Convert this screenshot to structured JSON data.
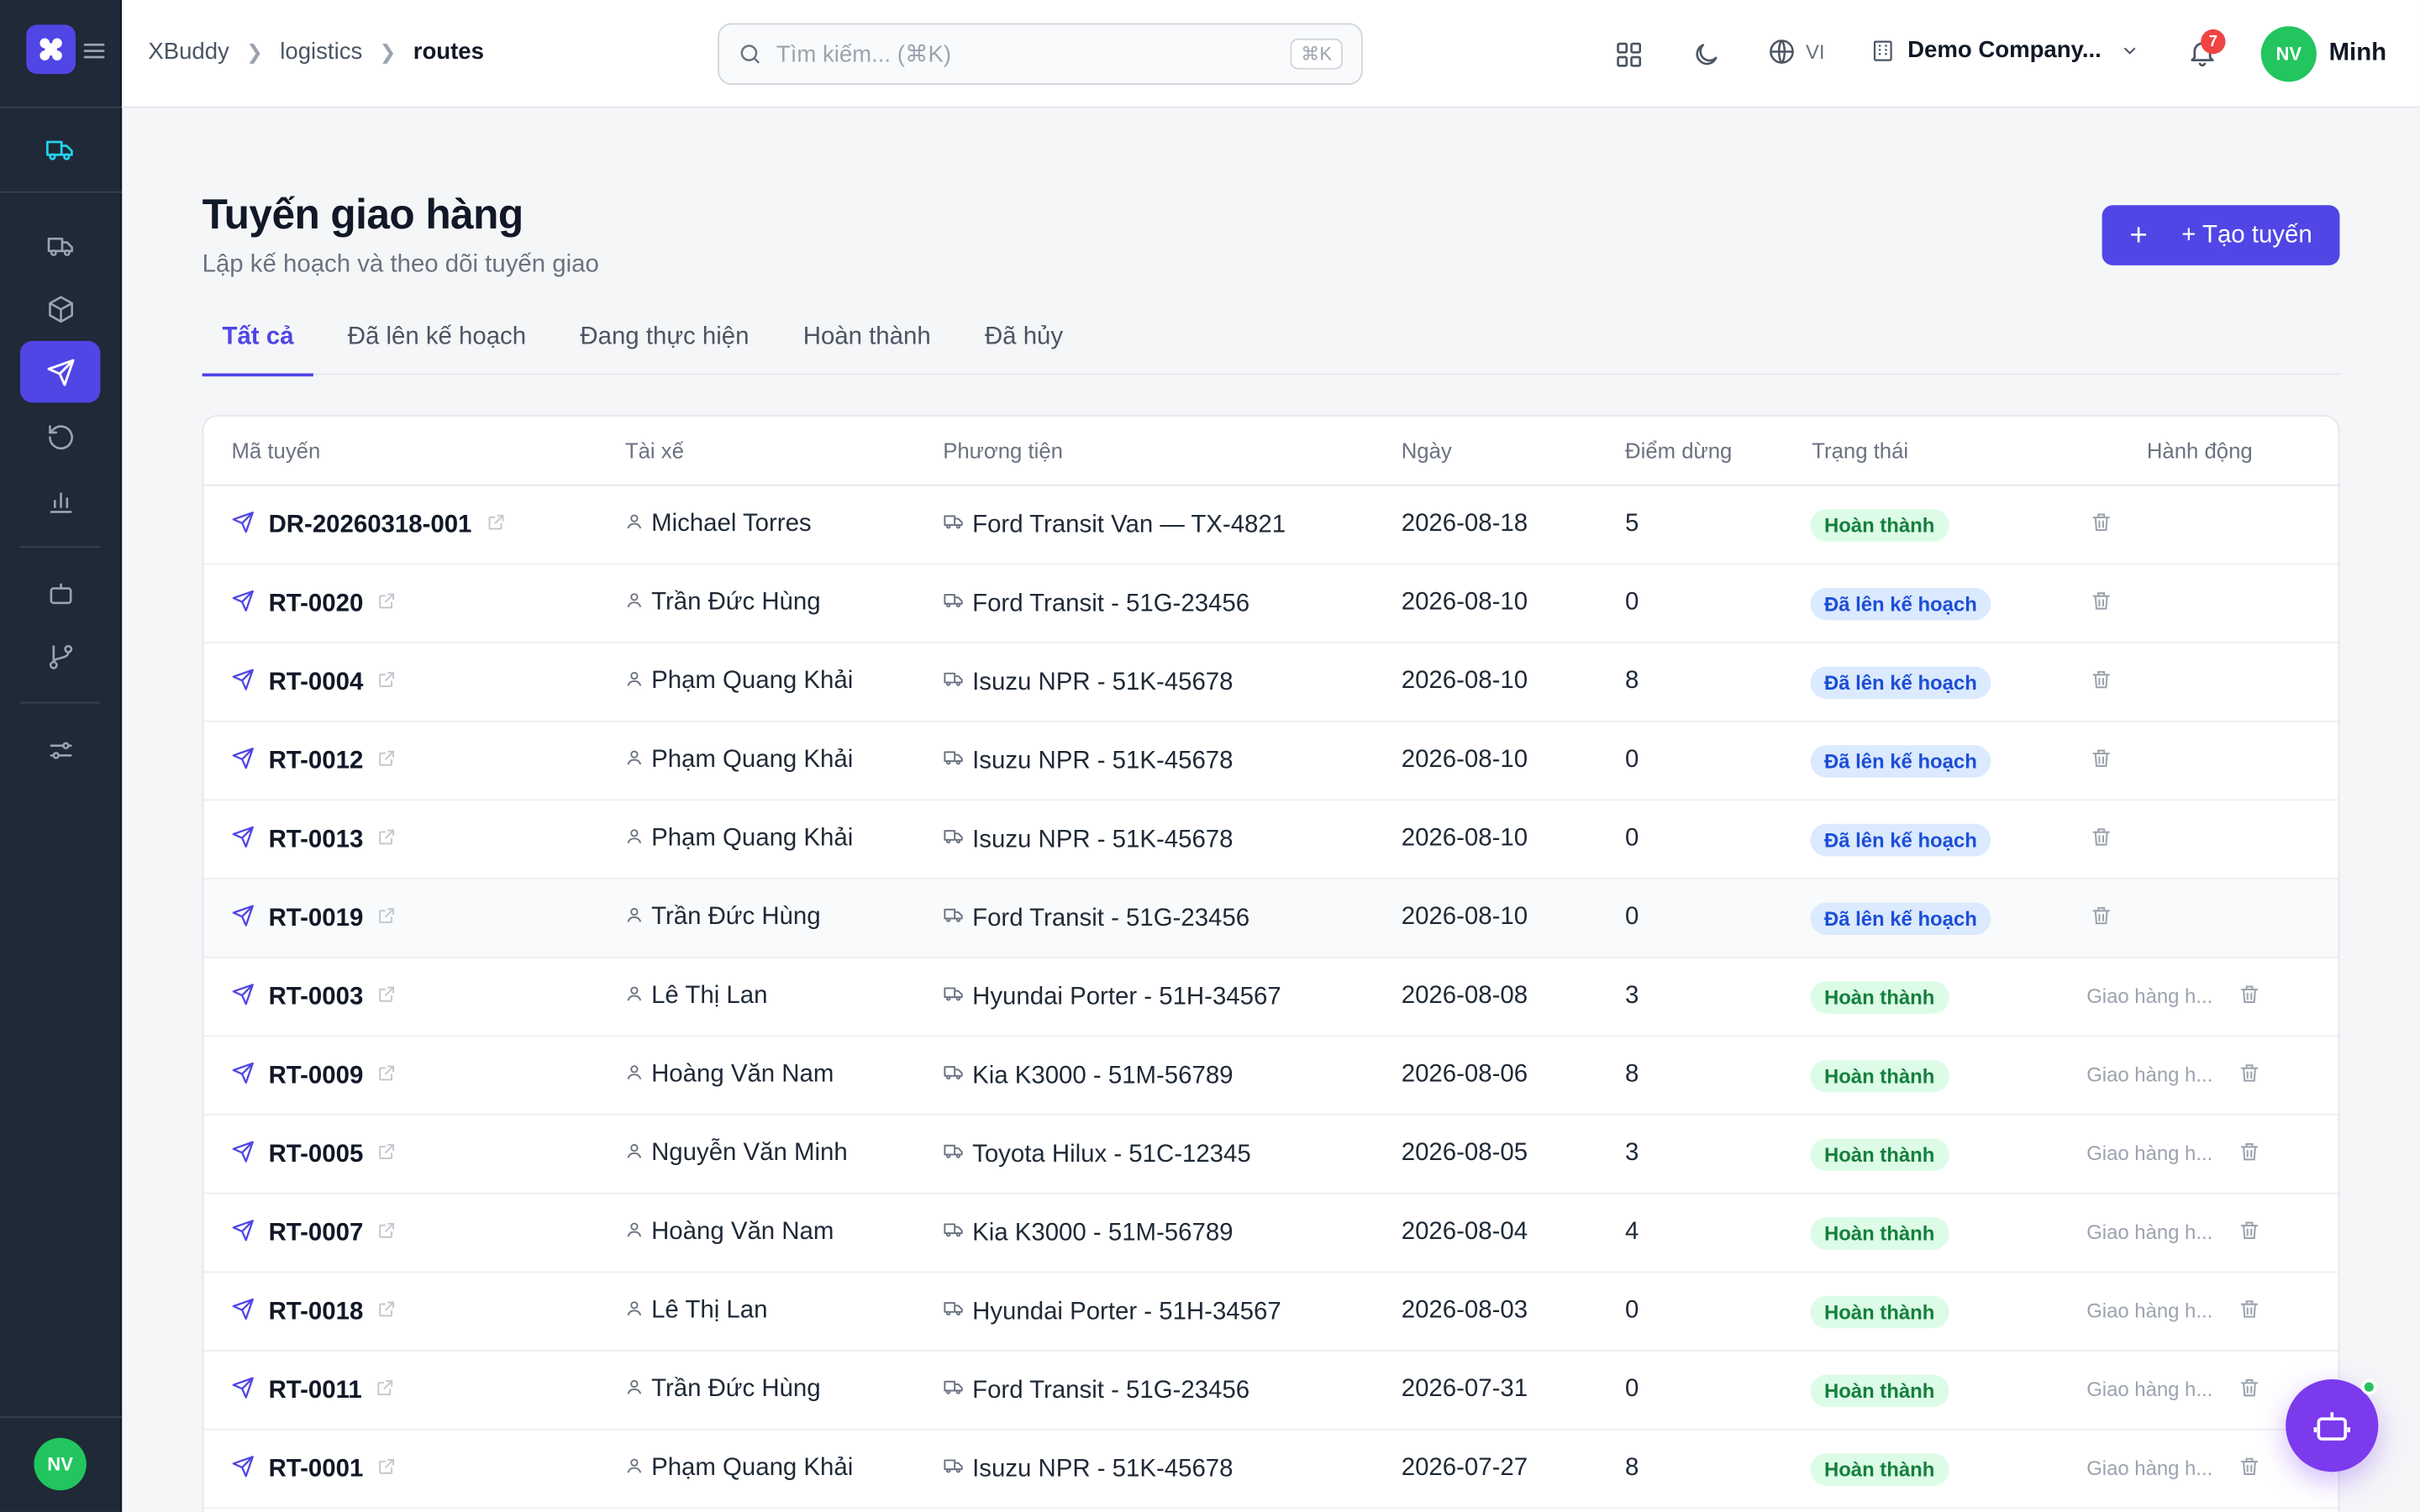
{
  "header": {
    "breadcrumbs": [
      "XBuddy",
      "logistics",
      "routes"
    ],
    "search_placeholder": "Tìm kiếm... (⌘K)",
    "search_shortcut": "⌘K",
    "language": "VI",
    "company": "Demo Company...",
    "notification_count": "7",
    "user_initials": "NV",
    "user_name": "Minh"
  },
  "sidebar": {
    "avatar_initials": "NV",
    "items": [
      "truck-icon",
      "truck-icon",
      "package-icon",
      "send-icon",
      "history-icon",
      "bar-chart-icon",
      "robot-icon",
      "git-branch-icon",
      "sliders-icon"
    ]
  },
  "page": {
    "title": "Tuyến giao hàng",
    "subtitle": "Lập kế hoạch và theo dõi tuyến giao",
    "create_label": "+ Tạo tuyến",
    "create_plus": "+"
  },
  "tabs": [
    "Tất cả",
    "Đã lên kế hoạch",
    "Đang thực hiện",
    "Hoàn thành",
    "Đã hủy"
  ],
  "table": {
    "headers": [
      "Mã tuyến",
      "Tài xế",
      "Phương tiện",
      "Ngày",
      "Điểm dừng",
      "Trạng thái",
      "Hành động"
    ],
    "rows": [
      {
        "code": "DR-20260318-001",
        "driver": "Michael Torres",
        "vehicle": "Ford Transit Van — TX-4821",
        "date": "2026-08-18",
        "stops": "5",
        "status": "Hoàn thành",
        "note": ""
      },
      {
        "code": "RT-0020",
        "driver": "Trần Đức Hùng",
        "vehicle": "Ford Transit - 51G-23456",
        "date": "2026-08-10",
        "stops": "0",
        "status": "Đã lên kế hoạch",
        "note": ""
      },
      {
        "code": "RT-0004",
        "driver": "Phạm Quang Khải",
        "vehicle": "Isuzu NPR - 51K-45678",
        "date": "2026-08-10",
        "stops": "8",
        "status": "Đã lên kế hoạch",
        "note": ""
      },
      {
        "code": "RT-0012",
        "driver": "Phạm Quang Khải",
        "vehicle": "Isuzu NPR - 51K-45678",
        "date": "2026-08-10",
        "stops": "0",
        "status": "Đã lên kế hoạch",
        "note": ""
      },
      {
        "code": "RT-0013",
        "driver": "Phạm Quang Khải",
        "vehicle": "Isuzu NPR - 51K-45678",
        "date": "2026-08-10",
        "stops": "0",
        "status": "Đã lên kế hoạch",
        "note": ""
      },
      {
        "code": "RT-0019",
        "driver": "Trần Đức Hùng",
        "vehicle": "Ford Transit - 51G-23456",
        "date": "2026-08-10",
        "stops": "0",
        "status": "Đã lên kế hoạch",
        "note": ""
      },
      {
        "code": "RT-0003",
        "driver": "Lê Thị Lan",
        "vehicle": "Hyundai Porter - 51H-34567",
        "date": "2026-08-08",
        "stops": "3",
        "status": "Hoàn thành",
        "note": "Giao hàng h..."
      },
      {
        "code": "RT-0009",
        "driver": "Hoàng Văn Nam",
        "vehicle": "Kia K3000 - 51M-56789",
        "date": "2026-08-06",
        "stops": "8",
        "status": "Hoàn thành",
        "note": "Giao hàng h..."
      },
      {
        "code": "RT-0005",
        "driver": "Nguyễn Văn Minh",
        "vehicle": "Toyota Hilux - 51C-12345",
        "date": "2026-08-05",
        "stops": "3",
        "status": "Hoàn thành",
        "note": "Giao hàng h..."
      },
      {
        "code": "RT-0007",
        "driver": "Hoàng Văn Nam",
        "vehicle": "Kia K3000 - 51M-56789",
        "date": "2026-08-04",
        "stops": "4",
        "status": "Hoàn thành",
        "note": "Giao hàng h..."
      },
      {
        "code": "RT-0018",
        "driver": "Lê Thị Lan",
        "vehicle": "Hyundai Porter - 51H-34567",
        "date": "2026-08-03",
        "stops": "0",
        "status": "Hoàn thành",
        "note": "Giao hàng h..."
      },
      {
        "code": "RT-0011",
        "driver": "Trần Đức Hùng",
        "vehicle": "Ford Transit - 51G-23456",
        "date": "2026-07-31",
        "stops": "0",
        "status": "Hoàn thành",
        "note": "Giao hàng h..."
      },
      {
        "code": "RT-0001",
        "driver": "Phạm Quang Khải",
        "vehicle": "Isuzu NPR - 51K-45678",
        "date": "2026-07-27",
        "stops": "8",
        "status": "Hoàn thành",
        "note": "Giao hàng h..."
      }
    ]
  },
  "colors": {
    "accent": "#4f46e5",
    "sidebar": "#1f2937",
    "done_bg": "#dcfce7",
    "done_fg": "#15803d",
    "plan_bg": "#dbeafe",
    "plan_fg": "#1d4ed8",
    "fab": "#7c3aed"
  }
}
